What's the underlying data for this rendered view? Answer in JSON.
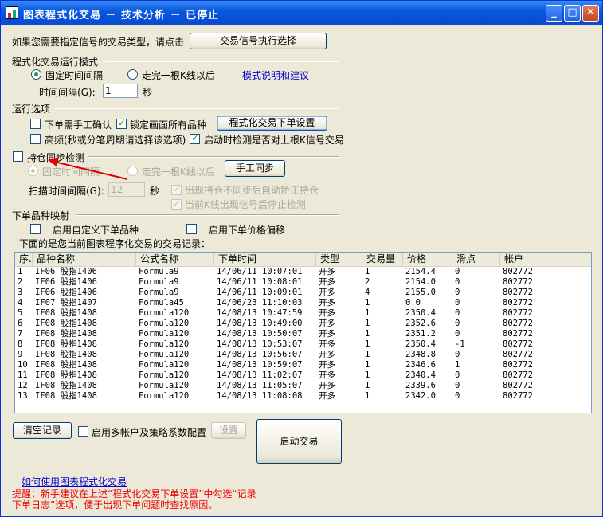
{
  "window": {
    "title": "图表程式化交易 － 技术分析 － 已停止",
    "min_label": "_",
    "max_label": "□",
    "close_label": "✕"
  },
  "top": {
    "prompt": "如果您需要指定信号的交易类型，请点击",
    "signal_button": "交易信号执行选择"
  },
  "mode": {
    "section_title": "程式化交易运行模式",
    "fixed_interval": "固定时间间隔",
    "after_bar": "走完一根K线以后",
    "help_link": "模式说明和建议",
    "interval_label": "时间间隔(G):",
    "interval_value": "1",
    "interval_unit": "秒",
    "selected": "fixed_interval"
  },
  "run_options": {
    "section_title": "运行选项",
    "manual_confirm": "下单需手工确认",
    "lock_all": "锁定画面所有品种",
    "order_settings_button": "程式化交易下单设置",
    "high_freq": "高频(秒或分笔周期请选择该选项)",
    "check_on_start": "启动时检测是否对上根K信号交易",
    "manual_confirm_checked": false,
    "lock_all_checked": true,
    "high_freq_checked": false,
    "check_on_start_checked": true
  },
  "sync": {
    "checkbox_label": "持仓同步检测",
    "checked": false,
    "fixed_interval": "固定时间间隔",
    "after_bar": "走完一根K线以后",
    "manual_sync_button": "手工同步",
    "scan_label": "扫描时间间隔(G):",
    "scan_value": "12",
    "scan_unit": "秒",
    "auto_correct": "出现持仓不同步后自动矫正持仓",
    "stop_detect": "当前K线出现信号后停止检测"
  },
  "mapping": {
    "section_title": "下单品种映射",
    "custom_symbol": "启用自定义下单品种",
    "price_offset": "启用下单价格偏移",
    "records_caption": "下面的是您当前图表程序化交易的交易记录："
  },
  "table": {
    "columns": [
      "序.",
      "品种名称",
      "公式名称",
      "下单时间",
      "类型",
      "交易量",
      "价格",
      "滑点",
      "帐户"
    ],
    "rows": [
      [
        "1",
        "IF06 股指1406",
        "Formula9",
        "14/06/11 10:07:01",
        "开多",
        "1",
        "2154.4",
        "0",
        "802772"
      ],
      [
        "2",
        "IF06 股指1406",
        "Formula9",
        "14/06/11 10:08:01",
        "开多",
        "2",
        "2154.0",
        "0",
        "802772"
      ],
      [
        "3",
        "IF06 股指1406",
        "Formula9",
        "14/06/11 10:09:01",
        "开多",
        "4",
        "2155.0",
        "0",
        "802772"
      ],
      [
        "4",
        "IF07 股指1407",
        "Formula45",
        "14/06/23 11:10:03",
        "开多",
        "1",
        "0.0",
        "0",
        "802772"
      ],
      [
        "5",
        "IF08 股指1408",
        "Formula120",
        "14/08/13 10:47:59",
        "开多",
        "1",
        "2350.4",
        "0",
        "802772"
      ],
      [
        "6",
        "IF08 股指1408",
        "Formula120",
        "14/08/13 10:49:00",
        "开多",
        "1",
        "2352.6",
        "0",
        "802772"
      ],
      [
        "7",
        "IF08 股指1408",
        "Formula120",
        "14/08/13 10:50:07",
        "开多",
        "1",
        "2351.2",
        "0",
        "802772"
      ],
      [
        "8",
        "IF08 股指1408",
        "Formula120",
        "14/08/13 10:53:07",
        "开多",
        "1",
        "2350.4",
        "-1",
        "802772"
      ],
      [
        "9",
        "IF08 股指1408",
        "Formula120",
        "14/08/13 10:56:07",
        "开多",
        "1",
        "2348.8",
        "0",
        "802772"
      ],
      [
        "10",
        "IF08 股指1408",
        "Formula120",
        "14/08/13 10:59:07",
        "开多",
        "1",
        "2346.6",
        "1",
        "802772"
      ],
      [
        "11",
        "IF08 股指1408",
        "Formula120",
        "14/08/13 11:02:07",
        "开多",
        "1",
        "2340.4",
        "0",
        "802772"
      ],
      [
        "12",
        "IF08 股指1408",
        "Formula120",
        "14/08/13 11:05:07",
        "开多",
        "1",
        "2339.6",
        "0",
        "802772"
      ],
      [
        "13",
        "IF08 股指1408",
        "Formula120",
        "14/08/13 11:08:08",
        "开多",
        "1",
        "2342.0",
        "0",
        "802772"
      ]
    ]
  },
  "bottom": {
    "clear_button": "清空记录",
    "multi_account": "启用多帐户及策略系数配置",
    "settings_button": "设置",
    "start_button": "启动交易",
    "howto_link": "如何使用图表程式化交易",
    "tip_line1": "提醒：新手建议在上述“程式化交易下单设置”中勾选“记录",
    "tip_line2": "下单日志”选项，便于出现下单问题时查找原因。"
  },
  "colors": {
    "title_bar": "#0a5ae0",
    "link": "#0000cc",
    "hint_text": "#e00000",
    "annotation_arrow": "#e00000"
  }
}
